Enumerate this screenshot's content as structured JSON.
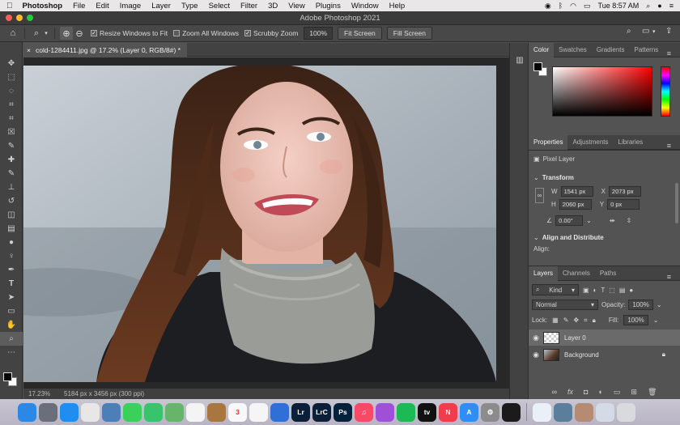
{
  "menubar": {
    "app_name": "Photoshop",
    "items": [
      "File",
      "Edit",
      "Image",
      "Layer",
      "Type",
      "Select",
      "Filter",
      "3D",
      "View",
      "Plugins",
      "Window",
      "Help"
    ],
    "clock": "Tue 8:57 AM"
  },
  "window": {
    "title": "Adobe Photoshop 2021"
  },
  "options": {
    "resize_windows": "Resize Windows to Fit",
    "zoom_all": "Zoom All Windows",
    "scrubby_zoom": "Scrubby Zoom",
    "zoom_value": "100%",
    "fit_screen": "Fit Screen",
    "fill_screen": "Fill Screen"
  },
  "document": {
    "tab_title": "cold-1284411.jpg @ 17.2% (Layer 0, RGB/8#) *",
    "close_glyph": "×"
  },
  "status": {
    "zoom": "17.23%",
    "info": "5184 px x 3456 px (300 ppi)"
  },
  "color_panel": {
    "tabs": [
      "Color",
      "Swatches",
      "Gradients",
      "Patterns"
    ],
    "foreground": "#000000",
    "background": "#ffffff"
  },
  "properties": {
    "tabs": [
      "Properties",
      "Adjustments",
      "Libraries"
    ],
    "layer_type": "Pixel Layer",
    "transform_label": "Transform",
    "w_label": "W",
    "w_value": "1541 px",
    "h_label": "H",
    "h_value": "2060 px",
    "x_label": "X",
    "x_value": "2073 px",
    "y_label": "Y",
    "y_value": "0 px",
    "angle_value": "0.00°",
    "align_label": "Align and Distribute",
    "align_sub": "Align:"
  },
  "layers_panel": {
    "tabs": [
      "Layers",
      "Channels",
      "Paths"
    ],
    "filter": "Kind",
    "blend_mode": "Normal",
    "opacity_label": "Opacity:",
    "opacity_value": "100%",
    "lock_label": "Lock:",
    "fill_label": "Fill:",
    "fill_value": "100%",
    "layers": [
      {
        "name": "Layer 0",
        "selected": true,
        "locked": false
      },
      {
        "name": "Background",
        "selected": false,
        "locked": true
      }
    ]
  },
  "dock": {
    "apps": [
      {
        "name": "Finder",
        "color": "#2b88e6",
        "label": ""
      },
      {
        "name": "Launchpad",
        "color": "#6b6f7c",
        "label": ""
      },
      {
        "name": "Safari",
        "color": "#1f8ef0",
        "label": ""
      },
      {
        "name": "Chrome",
        "color": "#e7e7e7",
        "label": ""
      },
      {
        "name": "Preview",
        "color": "#4c7fb8",
        "label": ""
      },
      {
        "name": "Messages",
        "color": "#3ad05a",
        "label": ""
      },
      {
        "name": "FaceTime",
        "color": "#38c46a",
        "label": ""
      },
      {
        "name": "Maps",
        "color": "#66b56a",
        "label": ""
      },
      {
        "name": "Photos",
        "color": "#f4f4f4",
        "label": ""
      },
      {
        "name": "Notes",
        "color": "#a8763e",
        "label": ""
      },
      {
        "name": "Calendar",
        "color": "#f8f8f8",
        "label": "3"
      },
      {
        "name": "Reminders",
        "color": "#f5f5f5",
        "label": ""
      },
      {
        "name": "Keynote",
        "color": "#2f6fd6",
        "label": ""
      },
      {
        "name": "Lightroom",
        "color": "#0b2038",
        "label": "Lr"
      },
      {
        "name": "Lightroom Classic",
        "color": "#0b2038",
        "label": "LrC"
      },
      {
        "name": "Photoshop",
        "color": "#06213b",
        "label": "Ps"
      },
      {
        "name": "Music",
        "color": "#f64a66",
        "label": "♫"
      },
      {
        "name": "Podcasts",
        "color": "#a050d8",
        "label": ""
      },
      {
        "name": "Spotify",
        "color": "#1db954",
        "label": ""
      },
      {
        "name": "TV",
        "color": "#111111",
        "label": "tv"
      },
      {
        "name": "News",
        "color": "#f03d4b",
        "label": "N"
      },
      {
        "name": "App Store",
        "color": "#2f8df5",
        "label": "A"
      },
      {
        "name": "System Preferences",
        "color": "#8c8c8c",
        "label": "⚙"
      },
      {
        "name": "Activity Monitor",
        "color": "#1b1b1b",
        "label": ""
      },
      {
        "name": "Mail",
        "color": "#e9f0f8",
        "label": ""
      },
      {
        "name": "Preview 2",
        "color": "#5b7e9c",
        "label": ""
      },
      {
        "name": "Photo",
        "color": "#b58b74",
        "label": ""
      },
      {
        "name": "Downloads",
        "color": "#d5dbe6",
        "label": ""
      },
      {
        "name": "Trash",
        "color": "#d9dade",
        "label": ""
      }
    ]
  }
}
